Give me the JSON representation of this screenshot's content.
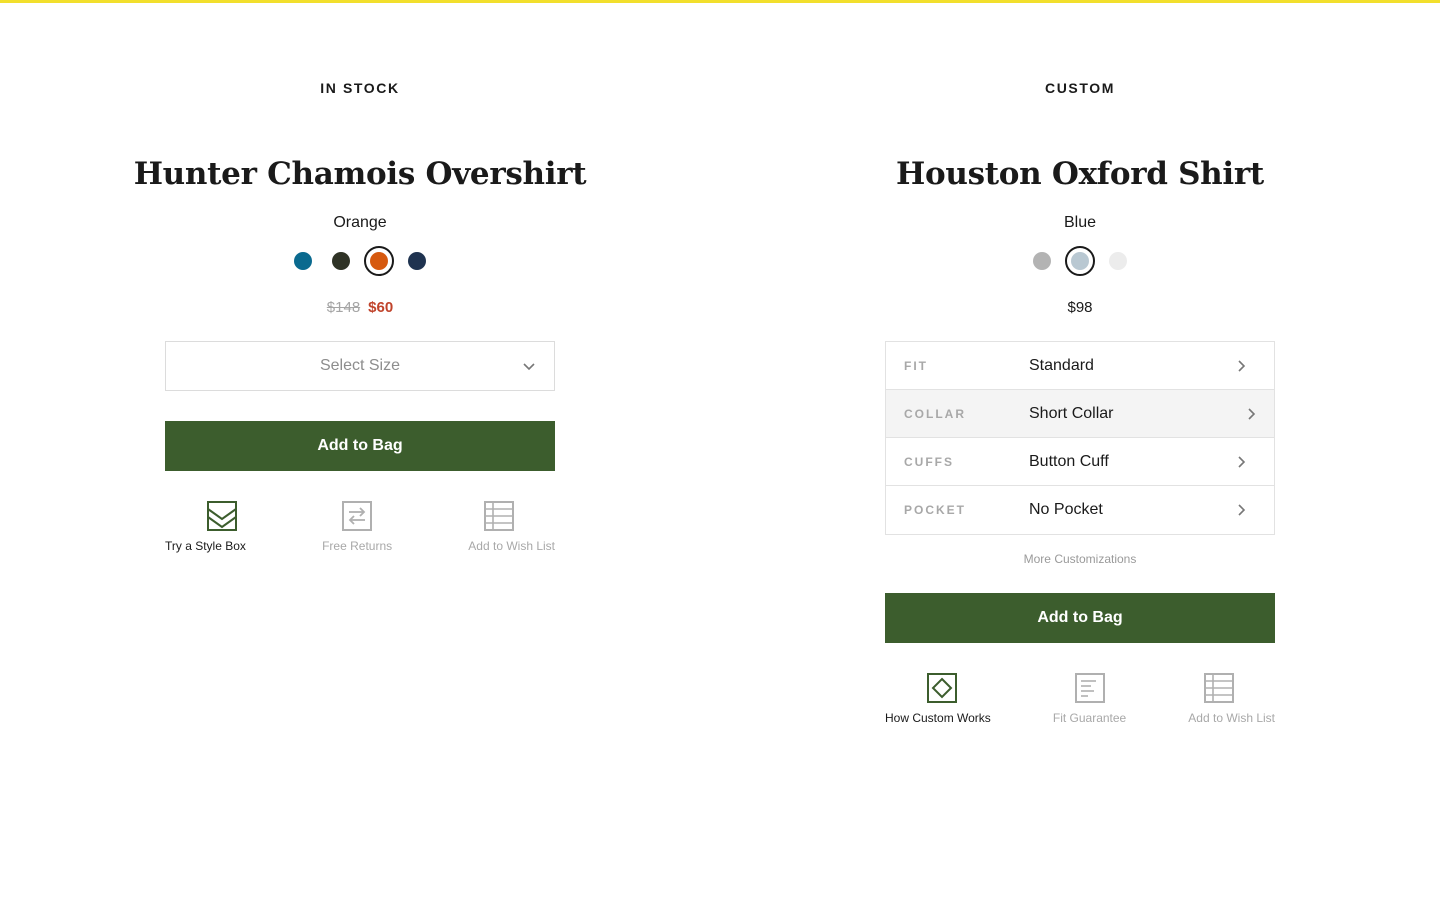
{
  "left": {
    "availability": "IN STOCK",
    "product_name": "Hunter Chamois Overshirt",
    "color_name": "Orange",
    "swatches": [
      {
        "name": "teal",
        "hex": "#0a6a8f"
      },
      {
        "name": "dark olive",
        "hex": "#2f3326"
      },
      {
        "name": "orange",
        "hex": "#d6590f",
        "selected": true
      },
      {
        "name": "navy",
        "hex": "#1f3350"
      }
    ],
    "price_original": "$148",
    "price_sale": "$60",
    "size_placeholder": "Select Size",
    "add_to_bag": "Add to Bag",
    "actions": [
      {
        "label": "Try a Style Box",
        "icon": "style-box-icon",
        "active": true
      },
      {
        "label": "Free Returns",
        "icon": "returns-icon",
        "active": false
      },
      {
        "label": "Add to Wish List",
        "icon": "wish-list-icon",
        "active": false
      }
    ]
  },
  "right": {
    "availability": "CUSTOM",
    "product_name": "Houston Oxford Shirt",
    "color_name": "Blue",
    "swatches": [
      {
        "name": "grey",
        "hex": "#b3b3b3"
      },
      {
        "name": "light blue",
        "hex": "#b9c8d2",
        "selected": true
      },
      {
        "name": "white",
        "hex": "#ececec"
      }
    ],
    "price": "$98",
    "options": [
      {
        "key": "FIT",
        "value": "Standard"
      },
      {
        "key": "COLLAR",
        "value": "Short Collar"
      },
      {
        "key": "CUFFS",
        "value": "Button Cuff"
      },
      {
        "key": "POCKET",
        "value": "No Pocket"
      }
    ],
    "more_customizations": "More Customizations",
    "add_to_bag": "Add to Bag",
    "actions": [
      {
        "label": "How Custom Works",
        "icon": "custom-works-icon",
        "active": true
      },
      {
        "label": "Fit Guarantee",
        "icon": "fit-guarantee-icon",
        "active": false
      },
      {
        "label": "Add to Wish List",
        "icon": "wish-list-icon",
        "active": false
      }
    ]
  },
  "colors": {
    "accent_yellow": "#f2df2c",
    "button_green": "#3c5d2d",
    "sale_red": "#c0432b"
  }
}
